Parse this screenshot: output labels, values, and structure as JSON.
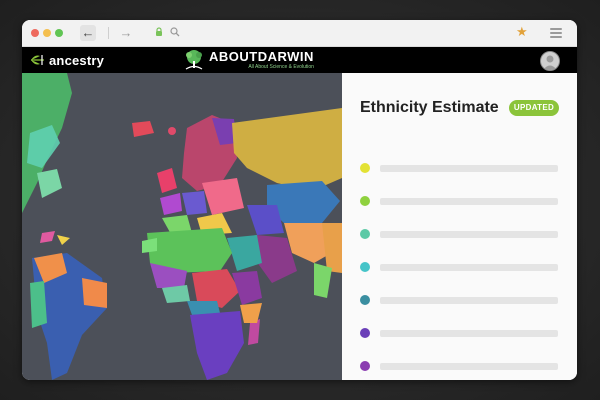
{
  "browser": {
    "back_icon": "arrow-left-icon",
    "forward_icon": "arrow-right-icon",
    "lock_icon": "lock-icon",
    "search_icon": "search-icon",
    "bookmark_icon": "star-icon",
    "menu_icon": "hamburger-menu-icon"
  },
  "header": {
    "ancestry_logo_text": "ancestry",
    "aboutdarwin_title": "ABOUTDARWIN",
    "aboutdarwin_subtitle": "All About Science & Evolution"
  },
  "panel": {
    "title": "Ethnicity Estimate",
    "badge": "UPDATED",
    "rows": [
      {
        "color": "#e3e234"
      },
      {
        "color": "#8fd13e"
      },
      {
        "color": "#5cc9a6"
      },
      {
        "color": "#45c4c8"
      },
      {
        "color": "#3a8ea0"
      },
      {
        "color": "#6a3fb8"
      },
      {
        "color": "#8a3cb0"
      },
      {
        "color": "#a04aa8"
      }
    ]
  },
  "colors": {
    "accent_green": "#8bc43a",
    "map_ocean": "#4c5059",
    "app_bar": "#000000"
  }
}
